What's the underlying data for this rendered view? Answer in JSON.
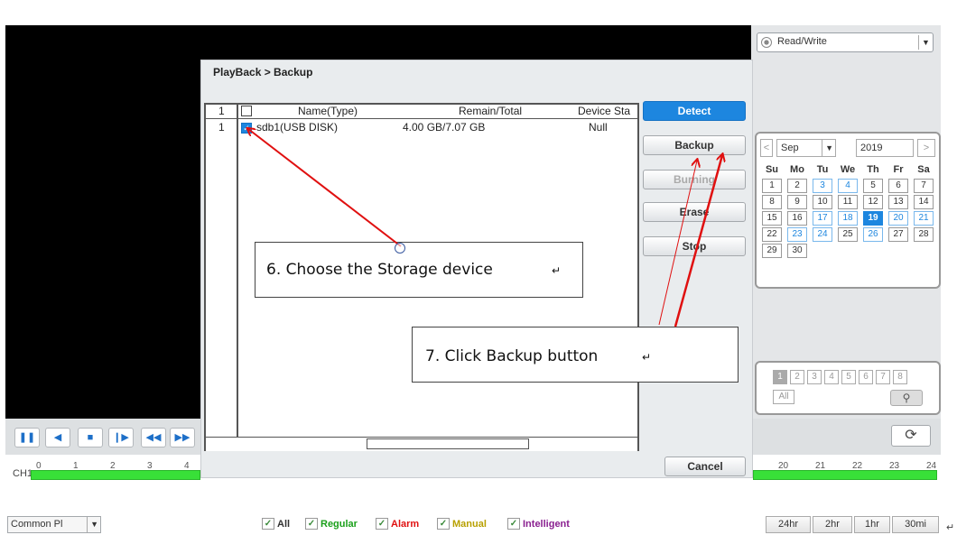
{
  "right_panel": {
    "mode_select": "Read/Write",
    "calendar": {
      "month": "Sep",
      "year": "2019",
      "prev_label": "<",
      "next_label": ">",
      "weekdays": [
        "Su",
        "Mo",
        "Tu",
        "We",
        "Th",
        "Fr",
        "Sa"
      ],
      "days": [
        "1",
        "2",
        "3",
        "4",
        "5",
        "6",
        "7",
        "8",
        "9",
        "10",
        "11",
        "12",
        "13",
        "14",
        "15",
        "16",
        "17",
        "18",
        "19",
        "20",
        "21",
        "22",
        "23",
        "24",
        "25",
        "26",
        "27",
        "28",
        "29",
        "30"
      ],
      "recorded_days": [
        "3",
        "4",
        "17",
        "18",
        "20",
        "21",
        "23",
        "24",
        "26"
      ],
      "selected_day": "19"
    },
    "channels": [
      "1",
      "2",
      "3",
      "4",
      "5",
      "6",
      "7",
      "8"
    ],
    "all_label": "All"
  },
  "dialog": {
    "title": "PlayBack > Backup",
    "columns": [
      "1",
      "Name(Type)",
      "Remain/Total",
      "Device Sta"
    ],
    "rows": [
      {
        "index": "1",
        "name": "sdb1(USB DISK)",
        "size": "4.00 GB/7.07 GB",
        "status": "Null"
      }
    ],
    "buttons": {
      "detect": "Detect",
      "backup": "Backup",
      "burning": "Burning",
      "erase": "Erase",
      "stop": "Stop",
      "cancel": "Cancel"
    }
  },
  "annotations": {
    "step6": "6. Choose the Storage device",
    "step7": "7. Click Backup button",
    "return_mark": "↵"
  },
  "timeline": {
    "channel": "CH1",
    "ticks_left": [
      "0",
      "1",
      "2",
      "3",
      "4"
    ],
    "ticks_right": [
      "20",
      "21",
      "22",
      "23",
      "24"
    ]
  },
  "bottom": {
    "common_select": "Common Pl",
    "filters": [
      {
        "label": "All",
        "color": "#333333"
      },
      {
        "label": "Regular",
        "color": "#1aa01a"
      },
      {
        "label": "Alarm",
        "color": "#e01010"
      },
      {
        "label": "Manual",
        "color": "#b8a000"
      },
      {
        "label": "Intelligent",
        "color": "#8a2090"
      }
    ],
    "ranges": [
      "24hr",
      "2hr",
      "1hr",
      "30mi"
    ]
  },
  "colors": {
    "accent": "#1d86df",
    "record_bar": "#38e038",
    "annotation_arrow": "#e01010"
  }
}
